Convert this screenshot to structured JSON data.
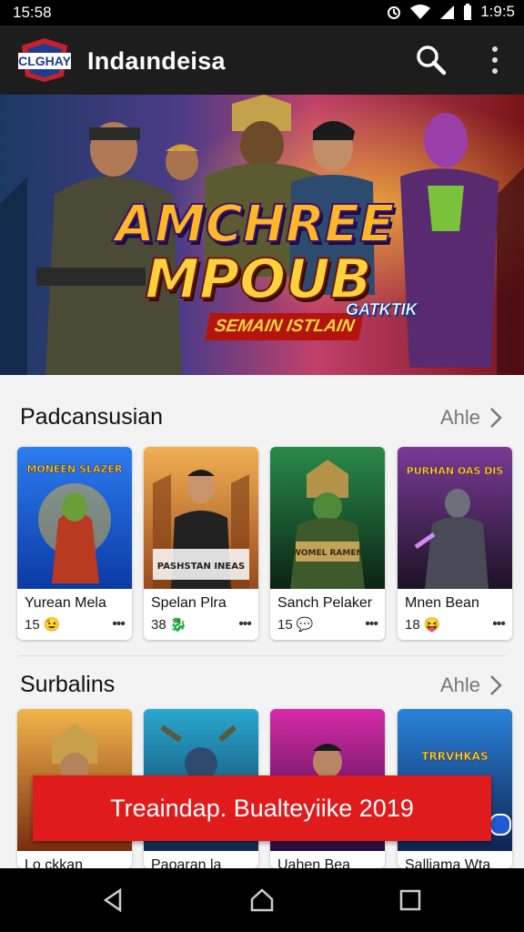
{
  "status_bar": {
    "time": "15:58",
    "battery_time": "1:9:5"
  },
  "app_bar": {
    "logo_text": "CLGHAY",
    "title": "Indaındeisa"
  },
  "hero": {
    "title_line1": "AMCHREE",
    "title_line2": "MPOUB",
    "subtitle": "SEMAIN ISTLAIN",
    "tag": "GATKTIK"
  },
  "sections": [
    {
      "title": "Padcansusian",
      "more_label": "Ahle",
      "cards": [
        {
          "name": "Yurean Mela",
          "meta": "15",
          "emoji": "😉",
          "thumb_text": "MONEEN SLAZER",
          "colors": [
            "#1b5fd8",
            "#f4c22b"
          ]
        },
        {
          "name": "Spelan Plra",
          "meta": "38",
          "emoji": "🐉",
          "thumb_text": "PASHSTAN INEAS",
          "colors": [
            "#e59a3c",
            "#8a3a14"
          ]
        },
        {
          "name": "Sanch Pelaker",
          "meta": "15",
          "emoji": "💬",
          "thumb_text": "WOMEL RAMEN",
          "colors": [
            "#1d6f3a",
            "#0c2b17"
          ]
        },
        {
          "name": "Mnen Bean",
          "meta": "18",
          "emoji": "😝",
          "thumb_text": "PURHAN OAS DIS",
          "colors": [
            "#6b2d86",
            "#22122e"
          ]
        }
      ]
    },
    {
      "title": "Surbalins",
      "more_label": "Ahle",
      "cards": [
        {
          "name": "Lo ckkan",
          "colors": [
            "#e8a136",
            "#7a2d0e"
          ]
        },
        {
          "name": "Paoaran la",
          "colors": [
            "#1d8fb3",
            "#102b4a"
          ]
        },
        {
          "name": "Uahen Bea",
          "colors": [
            "#c2229a",
            "#2b0d3a"
          ]
        },
        {
          "name": "Salliama Wta",
          "thumb_text": "TRRVHKAS",
          "colors": [
            "#2170c9",
            "#0f2453"
          ]
        }
      ]
    }
  ],
  "banner": {
    "text": "Treaindap. Bualteyiike 2019"
  }
}
